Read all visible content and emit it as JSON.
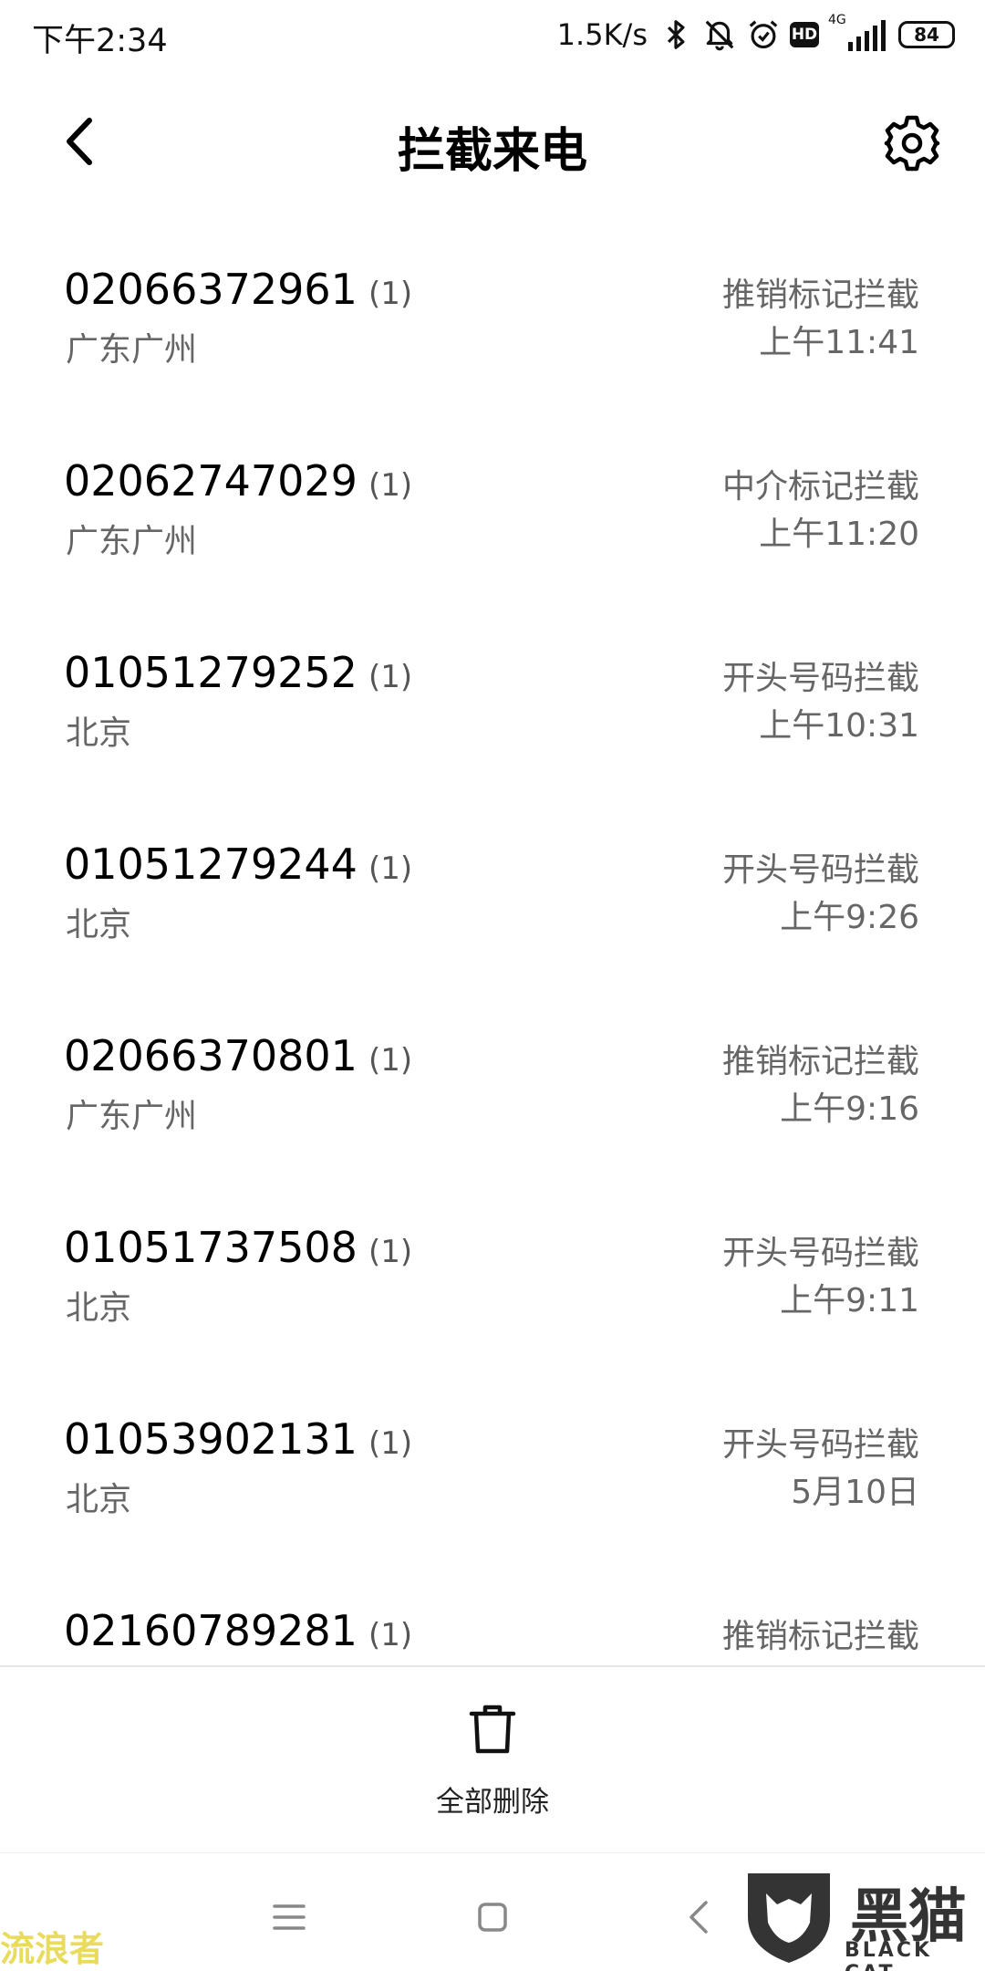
{
  "status_bar": {
    "time": "下午2:34",
    "net_speed": "1.5K/s",
    "network_type": "4G",
    "hd_label": "HD",
    "battery": "84",
    "icons": [
      "bluetooth-icon",
      "mute-bell-icon",
      "alarm-icon",
      "hd-icon",
      "signal-icon",
      "battery-icon"
    ]
  },
  "header": {
    "title": "拦截来电",
    "back_icon": "back-arrow-icon",
    "settings_icon": "gear-icon"
  },
  "calls": [
    {
      "number": "02066372961",
      "count": "(1)",
      "location": "广东广州",
      "reason": "推销标记拦截",
      "time": "上午11:41"
    },
    {
      "number": "02062747029",
      "count": "(1)",
      "location": "广东广州",
      "reason": "中介标记拦截",
      "time": "上午11:20"
    },
    {
      "number": "01051279252",
      "count": "(1)",
      "location": "北京",
      "reason": "开头号码拦截",
      "time": "上午10:31"
    },
    {
      "number": "01051279244",
      "count": "(1)",
      "location": "北京",
      "reason": "开头号码拦截",
      "time": "上午9:26"
    },
    {
      "number": "02066370801",
      "count": "(1)",
      "location": "广东广州",
      "reason": "推销标记拦截",
      "time": "上午9:16"
    },
    {
      "number": "01051737508",
      "count": "(1)",
      "location": "北京",
      "reason": "开头号码拦截",
      "time": "上午9:11"
    },
    {
      "number": "01053902131",
      "count": "(1)",
      "location": "北京",
      "reason": "开头号码拦截",
      "time": "5月10日"
    },
    {
      "number": "02160789281",
      "count": "(1)",
      "location": "",
      "reason": "推销标记拦截",
      "time": ""
    }
  ],
  "bottom_bar": {
    "delete_all_label": "全部删除",
    "delete_icon": "trash-icon"
  },
  "nav_bar": {
    "icons": [
      "menu-icon",
      "home-square-icon",
      "back-chevron-icon"
    ]
  },
  "watermarks": {
    "left_text": "流浪者",
    "logo_text": "黑猫",
    "logo_sub": "BLACK CAT"
  },
  "colors": {
    "primary_text": "#000000",
    "secondary_text": "#666666",
    "divider": "#e6e6e6",
    "watermark_yellow": "#e7d84c"
  }
}
